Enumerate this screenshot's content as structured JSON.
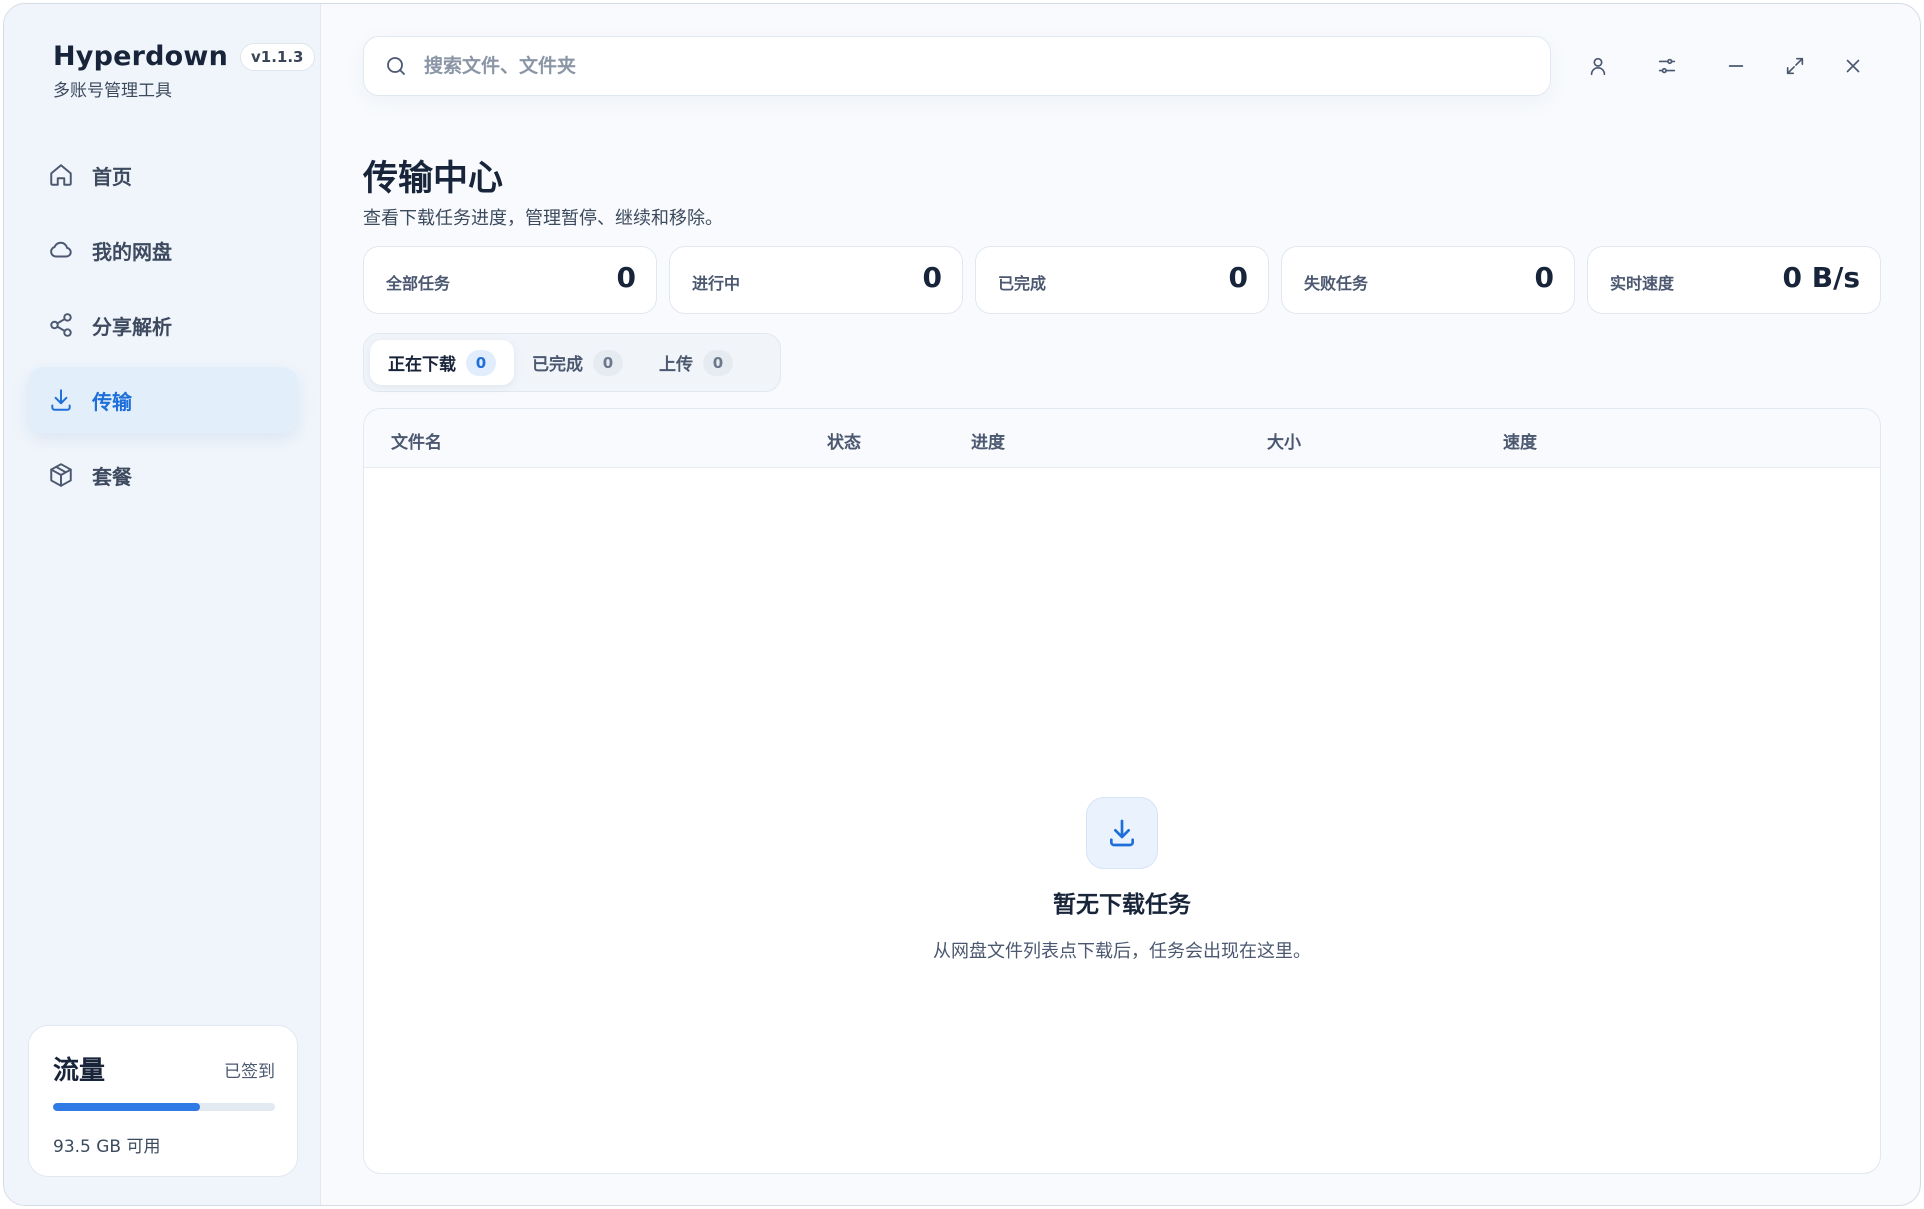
{
  "app": {
    "name": "Hyperdown",
    "version": "v1.1.3",
    "subtitle": "多账号管理工具"
  },
  "sidebar": {
    "items": [
      {
        "label": "首页",
        "icon": "home-icon"
      },
      {
        "label": "我的网盘",
        "icon": "cloud-icon"
      },
      {
        "label": "分享解析",
        "icon": "share-icon"
      },
      {
        "label": "传输",
        "icon": "download-icon",
        "active": true
      },
      {
        "label": "套餐",
        "icon": "package-icon"
      }
    ]
  },
  "quota": {
    "title": "流量",
    "status": "已签到",
    "available": "93.5 GB 可用",
    "used_fraction": 0.66
  },
  "search": {
    "placeholder": "搜索文件、文件夹"
  },
  "window_controls": [
    "user-icon",
    "settings-sliders-icon",
    "minimize-icon",
    "maximize-icon",
    "close-icon"
  ],
  "page": {
    "title": "传输中心",
    "description": "查看下载任务进度，管理暂停、继续和移除。"
  },
  "stats": [
    {
      "label": "全部任务",
      "value": "0"
    },
    {
      "label": "进行中",
      "value": "0"
    },
    {
      "label": "已完成",
      "value": "0"
    },
    {
      "label": "失败任务",
      "value": "0"
    },
    {
      "label": "实时速度",
      "value": "0 B/s"
    }
  ],
  "tabs": [
    {
      "label": "正在下载",
      "count": "0",
      "active": true
    },
    {
      "label": "已完成",
      "count": "0"
    },
    {
      "label": "上传",
      "count": "0"
    }
  ],
  "table": {
    "columns": [
      "文件名",
      "状态",
      "进度",
      "大小",
      "速度"
    ]
  },
  "empty_state": {
    "icon": "download-icon",
    "title": "暂无下载任务",
    "description": "从网盘文件列表点下载后，任务会出现在这里。"
  },
  "colors": {
    "accent": "#1e6fd9",
    "progress": "#2f7ae5",
    "sidebar_bg": "#f0f5fb"
  }
}
